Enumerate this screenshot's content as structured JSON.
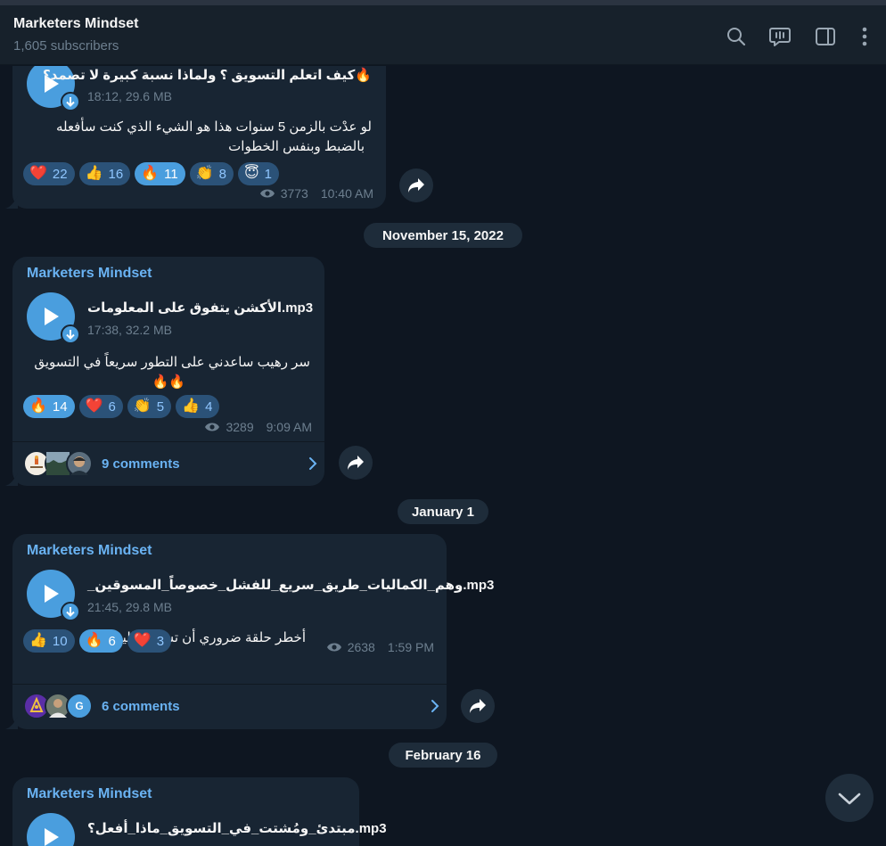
{
  "header": {
    "title": "Marketers Mindset",
    "subtitle": "1,605 subscribers",
    "icons": [
      "search-icon",
      "discussion-icon",
      "sidebar-toggle-icon",
      "more-vertical-icon"
    ]
  },
  "posts": [
    {
      "file_name": "🔥كيف اتعلم التسويق ؟ ولماذا نسبة كبيرة لا تصمد؟",
      "file_meta": "18:12, 29.6 MB",
      "caption_line1": "لو عدْت بالزمن 5 سنوات هذا هو الشيء الذي كنت سأفعله",
      "caption_line2": "بالضبط وبنفس الخطوات",
      "reactions": [
        {
          "emoji": "❤️",
          "count": "22"
        },
        {
          "emoji": "👍",
          "count": "16"
        },
        {
          "emoji": "🔥",
          "count": "11"
        },
        {
          "emoji": "👏",
          "count": "8"
        },
        {
          "emoji": "😇",
          "count": "1"
        }
      ],
      "views": "3773",
      "time": "10:40 AM"
    },
    {
      "sender": "Marketers Mindset",
      "file_name": "الأكشن يتفوق على المعلومات.mp3",
      "file_meta": "17:38, 32.2 MB",
      "caption_line1": "سر رهيب ساعدني على التطور سريعاً في التسويق",
      "caption_line2": "🔥🔥",
      "reactions": [
        {
          "emoji": "🔥",
          "count": "14"
        },
        {
          "emoji": "❤️",
          "count": "6"
        },
        {
          "emoji": "👏",
          "count": "5"
        },
        {
          "emoji": "👍",
          "count": "4"
        }
      ],
      "views": "3289",
      "time": "9:09 AM",
      "comments": "9 comments"
    },
    {
      "sender": "Marketers Mindset",
      "file_name": "_وهم_الكماليات_طريق_سريع_للفشل_خصوصاً_المسوقين.mp3",
      "file_meta": "21:45, 29.8 MB",
      "caption_line1": "أخطر حلقة ضروري أن تسمعها اليوم🔥",
      "reactions": [
        {
          "emoji": "👍",
          "count": "10"
        },
        {
          "emoji": "🔥",
          "count": "6"
        },
        {
          "emoji": "❤️",
          "count": "3"
        }
      ],
      "views": "2638",
      "time": "1:59 PM",
      "comments": "6 comments",
      "avatar_letter": "G"
    },
    {
      "sender": "Marketers Mindset",
      "file_name": "مبتدئ_ومُشتت_في_التسويق_ماذا_أفعل؟.mp3"
    }
  ],
  "dates": [
    "November 15, 2022",
    "January 1",
    "February 16"
  ],
  "colors": {
    "background": "#0e1621",
    "bubble": "#182533",
    "accent": "#4a9ede",
    "link": "#6ab3f3",
    "muted": "#6d7f8f"
  }
}
